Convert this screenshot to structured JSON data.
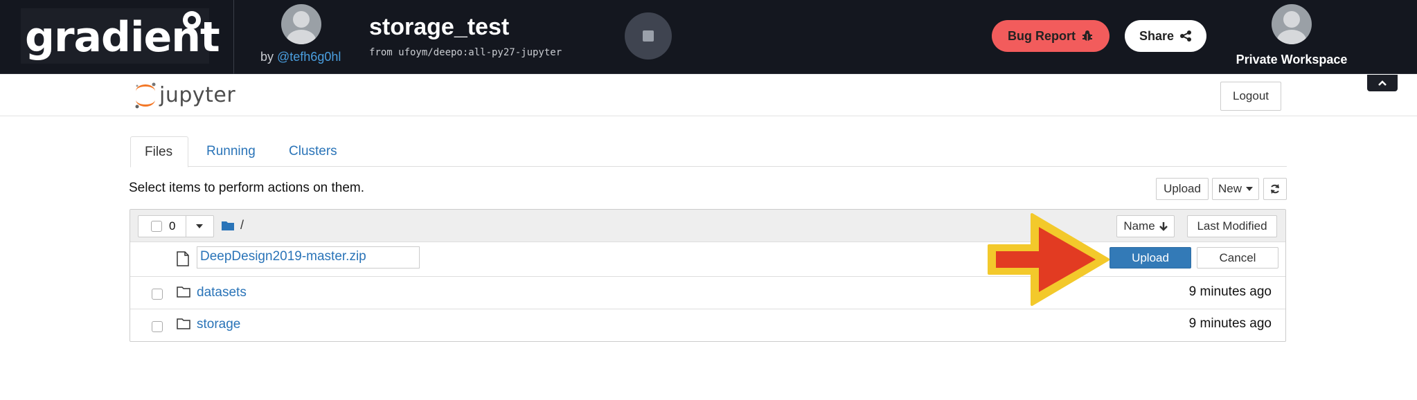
{
  "topbar": {
    "logo_text": "gradient",
    "author_prefix": "by ",
    "author_handle": "@tefh6g0hl",
    "project_title": "storage_test",
    "project_subtitle": "from ufoym/deepo:all-py27-jupyter",
    "bug_report_label": "Bug Report",
    "share_label": "Share",
    "workspace_label": "Private Workspace",
    "bug_color": "#f25c5c"
  },
  "jupyter": {
    "logo_text": "jupyter",
    "logout_label": "Logout"
  },
  "tabs": [
    {
      "label": "Files",
      "active": true
    },
    {
      "label": "Running",
      "active": false
    },
    {
      "label": "Clusters",
      "active": false
    }
  ],
  "toolbar": {
    "hint": "Select items to perform actions on them.",
    "upload_label": "Upload",
    "new_label": "New"
  },
  "list": {
    "selected_count": "0",
    "path": "/",
    "sort_name_label": "Name",
    "sort_modified_label": "Last Modified",
    "pending_upload": {
      "filename": "DeepDesign2019-master.zip",
      "upload_label": "Upload",
      "cancel_label": "Cancel"
    },
    "items": [
      {
        "name": "datasets",
        "modified": "9 minutes ago"
      },
      {
        "name": "storage",
        "modified": "9 minutes ago"
      }
    ]
  },
  "accent_color": "#337ab7",
  "link_color": "#2a74b8"
}
